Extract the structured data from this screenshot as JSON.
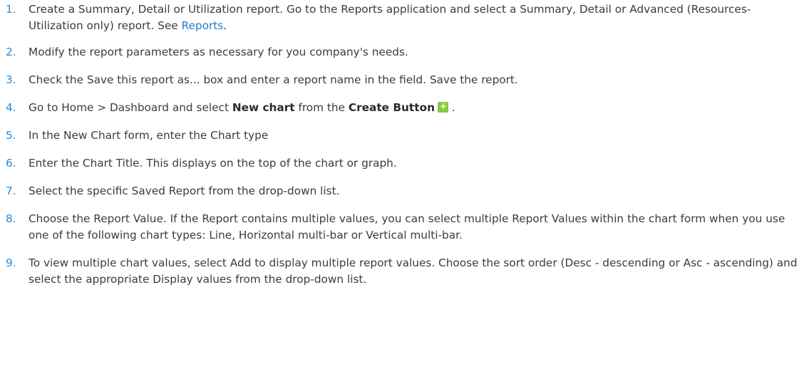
{
  "steps": [
    {
      "num": "1.",
      "pre": "Create a Summary, Detail or Utilization report. Go to the Reports application and select a Summary, Detail or Advanced (Resources-Utilization only) report. See ",
      "link": "Reports",
      "post": "."
    },
    {
      "num": "2.",
      "text": "Modify the report parameters as necessary for you company's needs."
    },
    {
      "num": "3.",
      "text": "Check the Save this report as... box and enter a report name in the field. Save the report."
    },
    {
      "num": "4.",
      "pre": "Go to Home > Dashboard and select ",
      "bold1": "New chart",
      "mid": " from the ",
      "bold2": "Create Button",
      "icon": "plus-icon",
      "post": " ."
    },
    {
      "num": "5.",
      "text": "In the New Chart form, enter the Chart type"
    },
    {
      "num": "6.",
      "text": "Enter the Chart Title. This displays on the top of the chart or graph."
    },
    {
      "num": "7.",
      "text": "Select the specific Saved Report from the drop-down list."
    },
    {
      "num": "8.",
      "text": "Choose the Report Value. If the Report contains multiple values, you can select multiple Report Values within the chart form when you use one of the following chart types: Line, Horizontal multi-bar or Vertical multi-bar."
    },
    {
      "num": "9.",
      "text": "To view multiple chart values, select Add to display multiple report values. Choose the sort order (Desc - descending or Asc - ascending) and select the appropriate Display values from the drop-down list."
    }
  ],
  "colors": {
    "number": "#2a8bd6",
    "link": "#1f7bc9",
    "text": "#3c3c3c",
    "icon_bg": "#8ac83e"
  }
}
